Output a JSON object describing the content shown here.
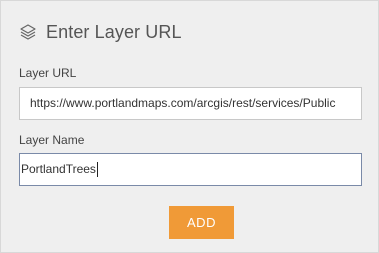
{
  "header": {
    "icon": "layers-icon",
    "title": "Enter Layer URL"
  },
  "layer_url": {
    "label": "Layer URL",
    "value": "https://www.portlandmaps.com/arcgis/rest/services/Public"
  },
  "layer_name": {
    "label": "Layer Name",
    "value": "PortlandTrees"
  },
  "actions": {
    "add_label": "ADD",
    "add_color": "#f09a37"
  }
}
